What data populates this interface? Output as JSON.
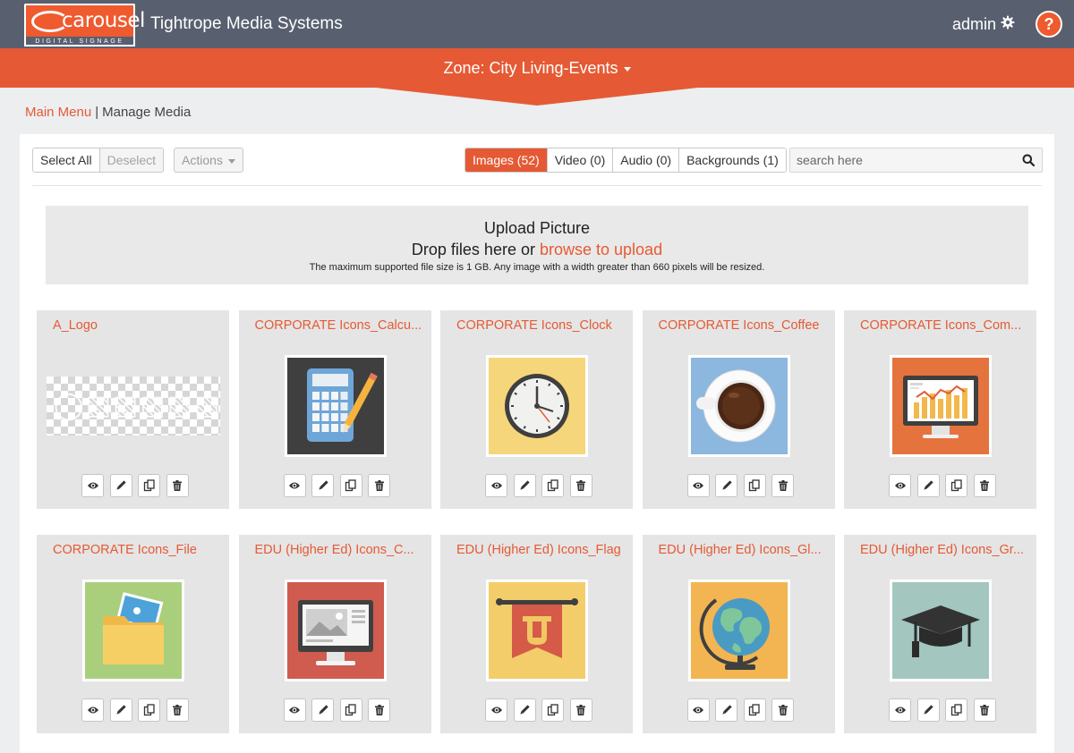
{
  "header": {
    "logo_text": "carousel",
    "logo_sub": "DIGITAL SIGNAGE",
    "app_title": "Tightrope Media Systems",
    "user": "admin",
    "help": "?"
  },
  "zone": {
    "title": "Zone: City Living-Events"
  },
  "breadcrumb": {
    "root": "Main Menu",
    "separator": "|",
    "current": "Manage Media"
  },
  "toolbar": {
    "select_all": "Select All",
    "deselect": "Deselect",
    "actions": "Actions",
    "tabs": [
      {
        "label": "Images (52)",
        "active": true
      },
      {
        "label": "Video (0)",
        "active": false
      },
      {
        "label": "Audio (0)",
        "active": false
      },
      {
        "label": "Backgrounds (1)",
        "active": false
      }
    ],
    "search_placeholder": "search here"
  },
  "upload": {
    "title": "Upload Picture",
    "drop_text": "Drop files here or",
    "browse_link": "browse to upload",
    "note": "The maximum supported file size is 1 GB. Any image with a width greater than 660 pixels will be resized."
  },
  "media": [
    {
      "title": "A_Logo",
      "thumb": "transparent-logo"
    },
    {
      "title": "CORPORATE Icons_Calcu...",
      "thumb": "calculator-icon"
    },
    {
      "title": "CORPORATE Icons_Clock",
      "thumb": "clock-icon"
    },
    {
      "title": "CORPORATE Icons_Coffee",
      "thumb": "coffee-icon"
    },
    {
      "title": "CORPORATE Icons_Com...",
      "thumb": "computer-chart-icon"
    },
    {
      "title": "CORPORATE Icons_File",
      "thumb": "folder-icon"
    },
    {
      "title": "EDU (Higher Ed) Icons_C...",
      "thumb": "monitor-icon"
    },
    {
      "title": "EDU (Higher Ed) Icons_Flag",
      "thumb": "pennant-flag-icon"
    },
    {
      "title": "EDU (Higher Ed) Icons_Gl...",
      "thumb": "globe-icon"
    },
    {
      "title": "EDU (Higher Ed) Icons_Gr...",
      "thumb": "graduation-cap-icon"
    }
  ],
  "colors": {
    "accent": "#e55a34",
    "header_bg": "#586070"
  }
}
